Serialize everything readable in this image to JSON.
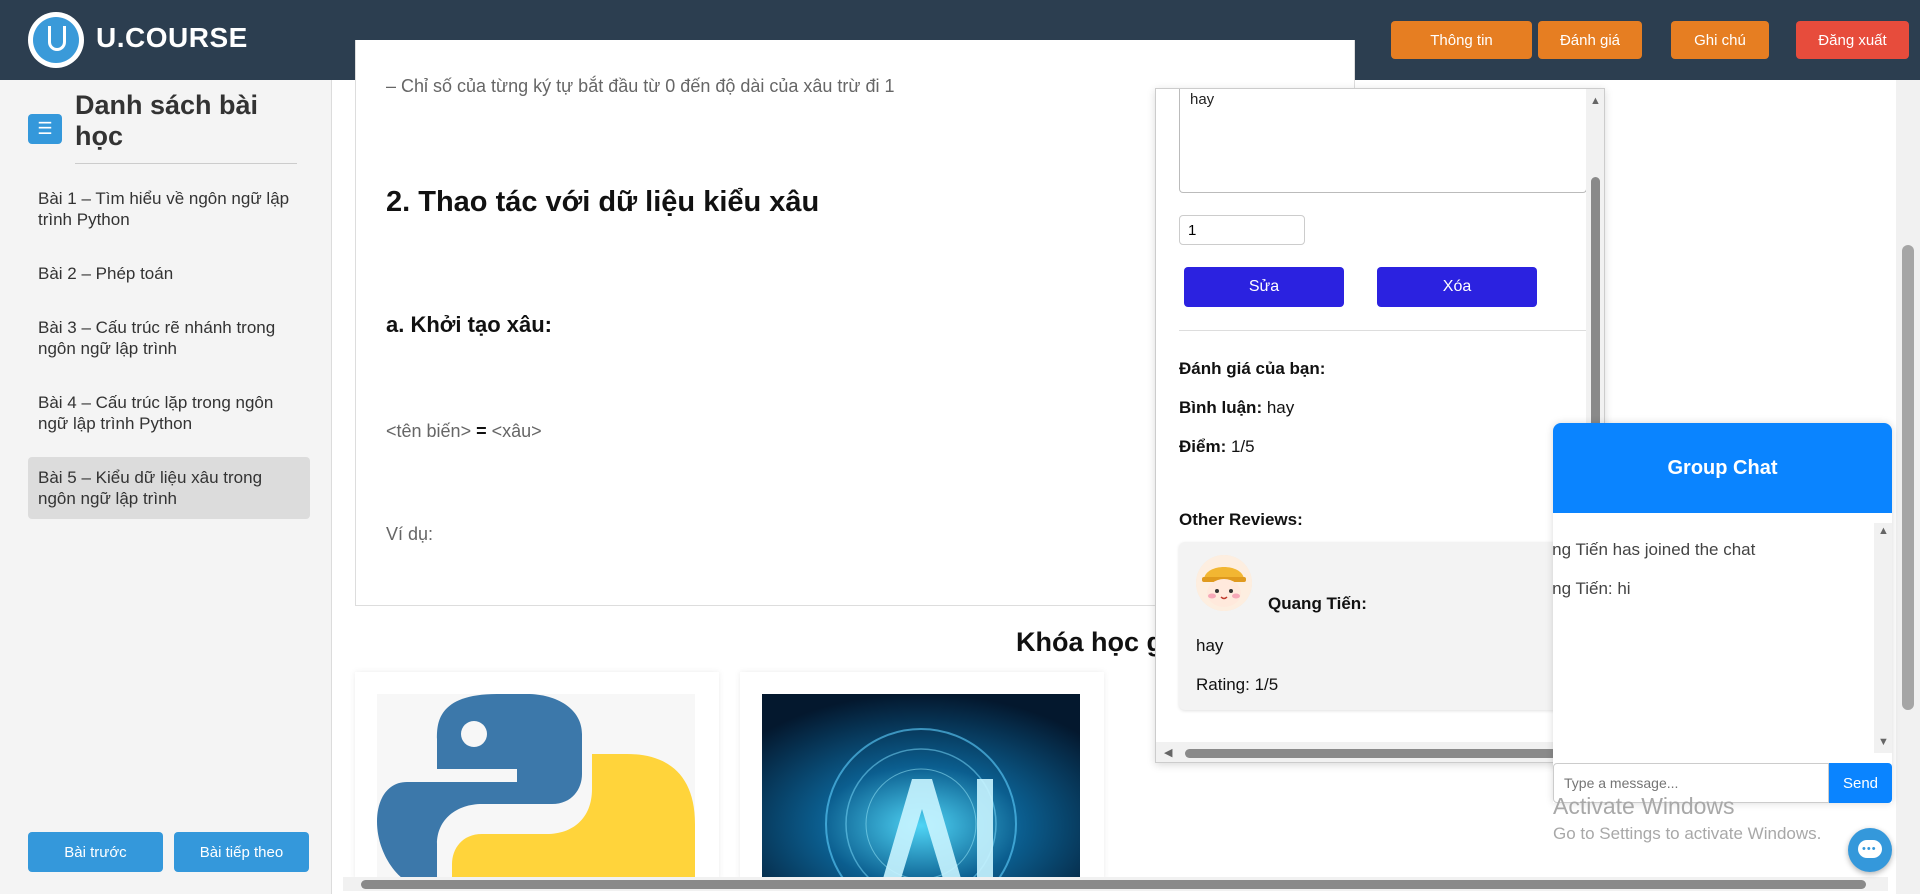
{
  "app": {
    "logo_text": "U.COURSE"
  },
  "header": {
    "buttons": {
      "info": "Thông tin",
      "review": "Đánh giá",
      "notes": "Ghi chú",
      "logout": "Đăng xuất"
    }
  },
  "sidebar": {
    "menu_icon": "☰",
    "title": "Danh sách bài học",
    "lessons": [
      {
        "label": "Bài 1 – Tìm hiểu về ngôn ngữ lập trình Python"
      },
      {
        "label": "Bài 2 – Phép toán"
      },
      {
        "label": "Bài 3 – Cấu trúc rẽ nhánh trong ngôn ngữ lập trình"
      },
      {
        "label": "Bài 4 – Cấu trúc lặp trong ngôn ngữ lập trình Python"
      },
      {
        "label": "Bài 5 – Kiểu dữ liệu xâu trong ngôn ngữ lập trình"
      }
    ],
    "active_lesson": 4,
    "prev_button": "Bài trước",
    "next_button": "Bài tiếp theo"
  },
  "content": {
    "partial_line": "– Chỉ số của từng ký tự bắt đầu từ 0 đến độ dài của xâu trừ đi 1",
    "heading_2": "2. Thao tác với dữ liệu kiểu xâu",
    "heading_3": "a. Khởi tạo xâu:",
    "syntax_left": "<tên biến>",
    "syntax_eq": " = ",
    "syntax_right": "<xâu>",
    "example_label": "Ví dụ:",
    "related_title": "Khóa học g"
  },
  "review_panel": {
    "comment_value": "hay",
    "score_value": "1",
    "edit_button": "Sửa",
    "delete_button": "Xóa",
    "your_review_label": "Đánh giá của bạn:",
    "comment_label": "Bình luận:",
    "comment_text": "hay",
    "score_label": "Điểm:",
    "score_text": "1/5",
    "other_reviews_label": "Other Reviews:",
    "other_reviews": [
      {
        "name": "Quang Tiến:",
        "comment": "hay",
        "rating": "Rating: 1/5"
      }
    ]
  },
  "chat": {
    "title": "Group Chat",
    "messages": [
      {
        "text": "Quang Tiến has joined the chat"
      },
      {
        "text": "Quang Tiến: hi"
      }
    ],
    "input_placeholder": "Type a message...",
    "send_button": "Send"
  },
  "watermark": {
    "line1": "Activate Windows",
    "line2": "Go to Settings to activate Windows."
  },
  "icons": {
    "menu": "hamburger-icon",
    "chat_bubble": "chat-bubble-icon",
    "python_logo": "python-logo",
    "ai_image": "ai-course-image"
  },
  "colors": {
    "header_bg": "#2c3e50",
    "orange": "#e67e22",
    "red": "#e74c3c",
    "blue": "#3498db",
    "action_blue": "#2b22e0",
    "chat_blue": "#0a84ff"
  }
}
